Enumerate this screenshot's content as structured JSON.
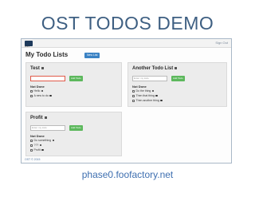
{
  "slide": {
    "title": "OST TODOS DEMO",
    "caption": "phase0.foofactory.net"
  },
  "app": {
    "logo_text": "OST",
    "signout_label": "Sign Out",
    "heading": "My Todo Lists",
    "new_list_label": "New List",
    "footer_text": "OST © 2015"
  },
  "lists": [
    {
      "title": "Test",
      "input_placeholder": "",
      "add_label": "Add Todo",
      "section_label": "Not Done",
      "todos": [
        "Hello",
        "A new to do"
      ]
    },
    {
      "title": "Another Todo List",
      "input_placeholder": "Enter my todo",
      "add_label": "Add Todo",
      "section_label": "Not Done",
      "todos": [
        "Do the thing",
        "Then that thing",
        "Then another thing"
      ]
    },
    {
      "title": "Profit",
      "input_placeholder": "Enter my todo",
      "add_label": "Add Todo",
      "section_label": "Not Done",
      "todos": [
        "Do something",
        "???",
        "Profit"
      ]
    }
  ],
  "colors": {
    "title": "#3e5f82",
    "caption": "#3e6fb0",
    "primary_button": "#3a82c4",
    "success_button": "#5cb85c"
  }
}
